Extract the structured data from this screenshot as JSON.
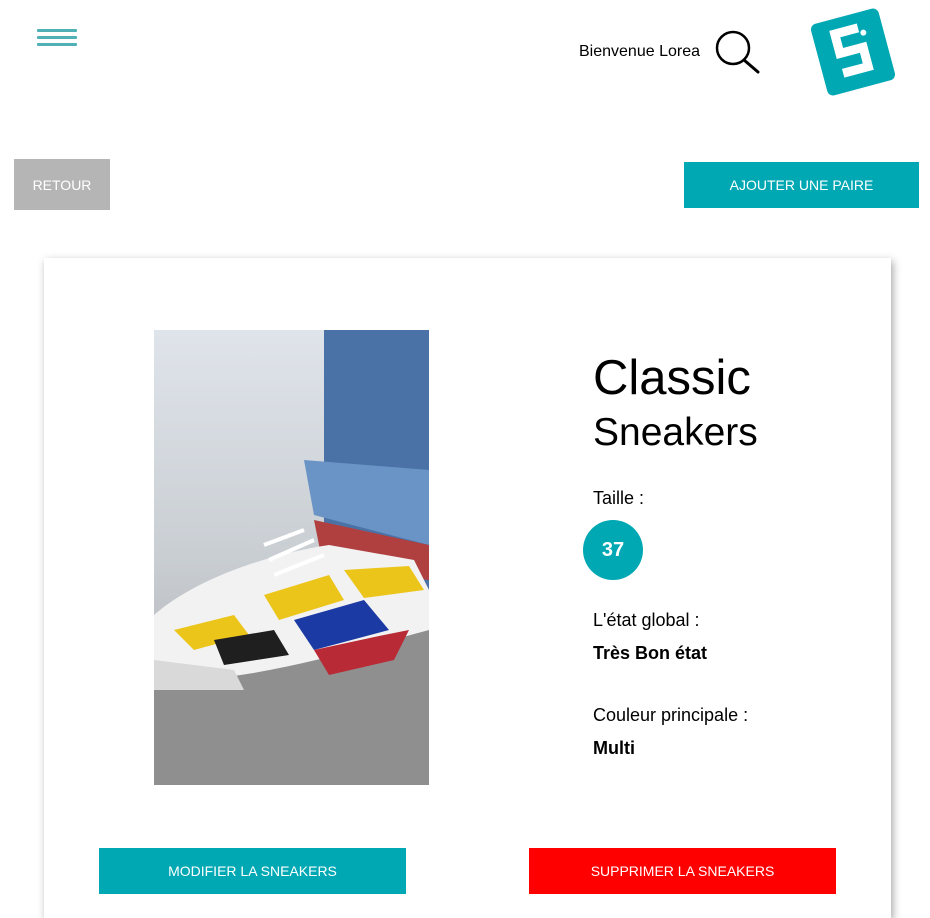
{
  "header": {
    "welcome_text": "Bienvenue Lorea",
    "menu_icon": "hamburger-menu-icon",
    "search_icon": "search-icon",
    "logo": "brand-logo",
    "accent_color": "#00a8b4"
  },
  "actions": {
    "back_label": "RETOUR",
    "add_label": "AJOUTER UNE PAIRE"
  },
  "product": {
    "title_line1": "Classic",
    "title_line2": "Sneakers",
    "size_label": "Taille :",
    "size_value": "37",
    "condition_label": "L'état global :",
    "condition_value": "Très Bon état",
    "color_label": "Couleur principale :",
    "color_value": "Multi"
  },
  "card_actions": {
    "modify_label": "MODIFIER LA SNEAKERS",
    "delete_label": "SUPPRIMER LA SNEAKERS",
    "delete_color": "#ff0000"
  }
}
